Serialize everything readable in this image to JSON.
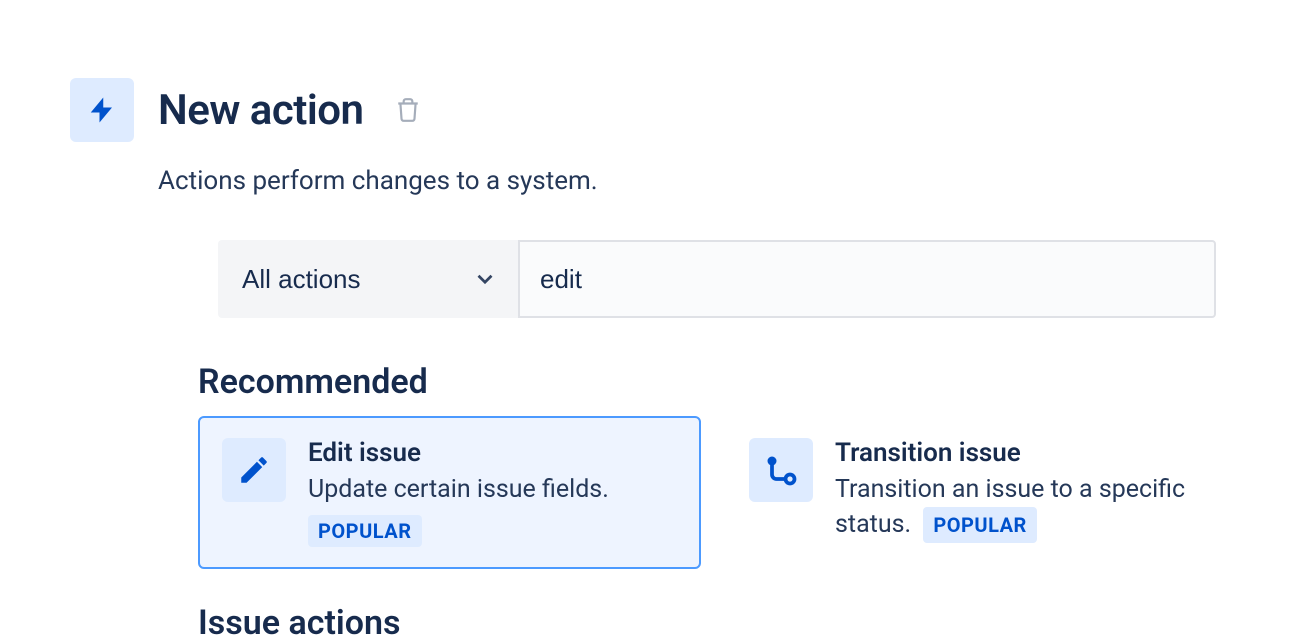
{
  "header": {
    "title": "New action",
    "subtitle": "Actions perform changes to a system."
  },
  "controls": {
    "dropdown_label": "All actions",
    "search_value": "edit"
  },
  "sections": {
    "recommended": "Recommended",
    "issue_actions": "Issue actions"
  },
  "cards": {
    "edit_issue": {
      "title": "Edit issue",
      "desc": "Update certain issue fields.",
      "badge": "POPULAR"
    },
    "transition_issue": {
      "title": "Transition issue",
      "desc": "Transition an issue to a specific status.",
      "badge": "POPULAR"
    }
  }
}
